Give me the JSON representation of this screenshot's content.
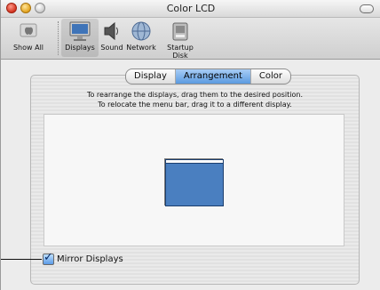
{
  "window": {
    "title": "Color LCD"
  },
  "toolbar": {
    "items": [
      {
        "label": "Show All",
        "icon": "apple-logo-icon"
      },
      {
        "label": "Displays",
        "icon": "display-icon",
        "selected": true
      },
      {
        "label": "Sound",
        "icon": "speaker-icon"
      },
      {
        "label": "Network",
        "icon": "network-globe-icon"
      },
      {
        "label": "Startup Disk",
        "icon": "startup-disk-icon"
      }
    ]
  },
  "tabs": [
    {
      "label": "Display",
      "active": false
    },
    {
      "label": "Arrangement",
      "active": true
    },
    {
      "label": "Color",
      "active": false
    }
  ],
  "instructions": {
    "line1": "To rearrange the displays, drag them to the desired position.",
    "line2": "To relocate the menu bar, drag it to a different display."
  },
  "mirror": {
    "label": "Mirror Displays",
    "checked": true
  },
  "colors": {
    "accent": "#5b9ae0",
    "display_blue": "#4a7fc0"
  }
}
